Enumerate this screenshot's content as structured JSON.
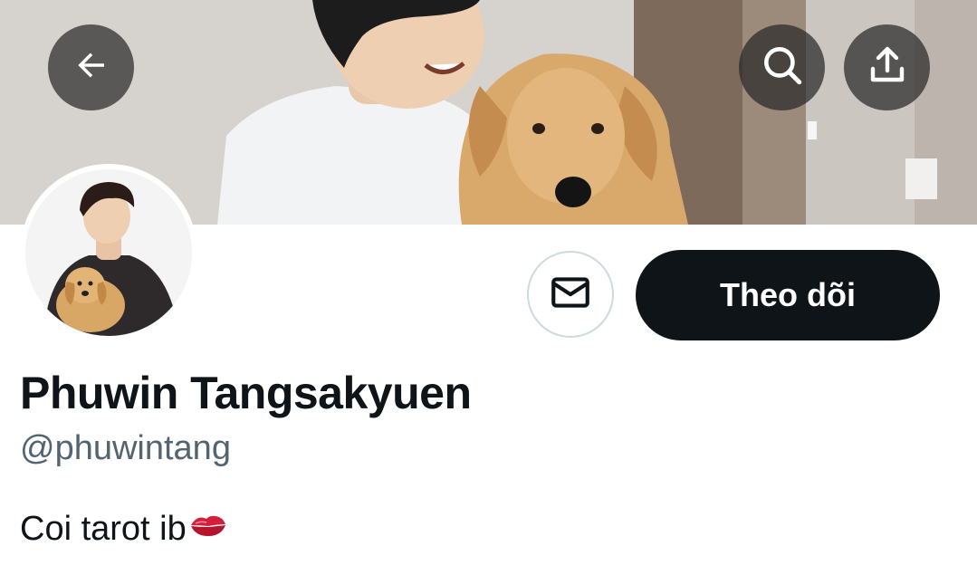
{
  "header": {
    "back_icon": "arrow-left-icon",
    "search_icon": "search-icon",
    "share_icon": "share-upload-icon"
  },
  "profile": {
    "display_name": "Phuwin Tangsakyuen",
    "handle": "@phuwintang",
    "bio_text": "Coi tarot ib",
    "bio_emoji": "kiss-mark-icon"
  },
  "actions": {
    "message_icon": "mail-icon",
    "follow_label": "Theo dõi"
  },
  "colors": {
    "primary_text": "#0f1419",
    "secondary_text": "#536471",
    "follow_button_bg": "#0f1419",
    "follow_button_text": "#ffffff",
    "border": "#cfd9de"
  }
}
